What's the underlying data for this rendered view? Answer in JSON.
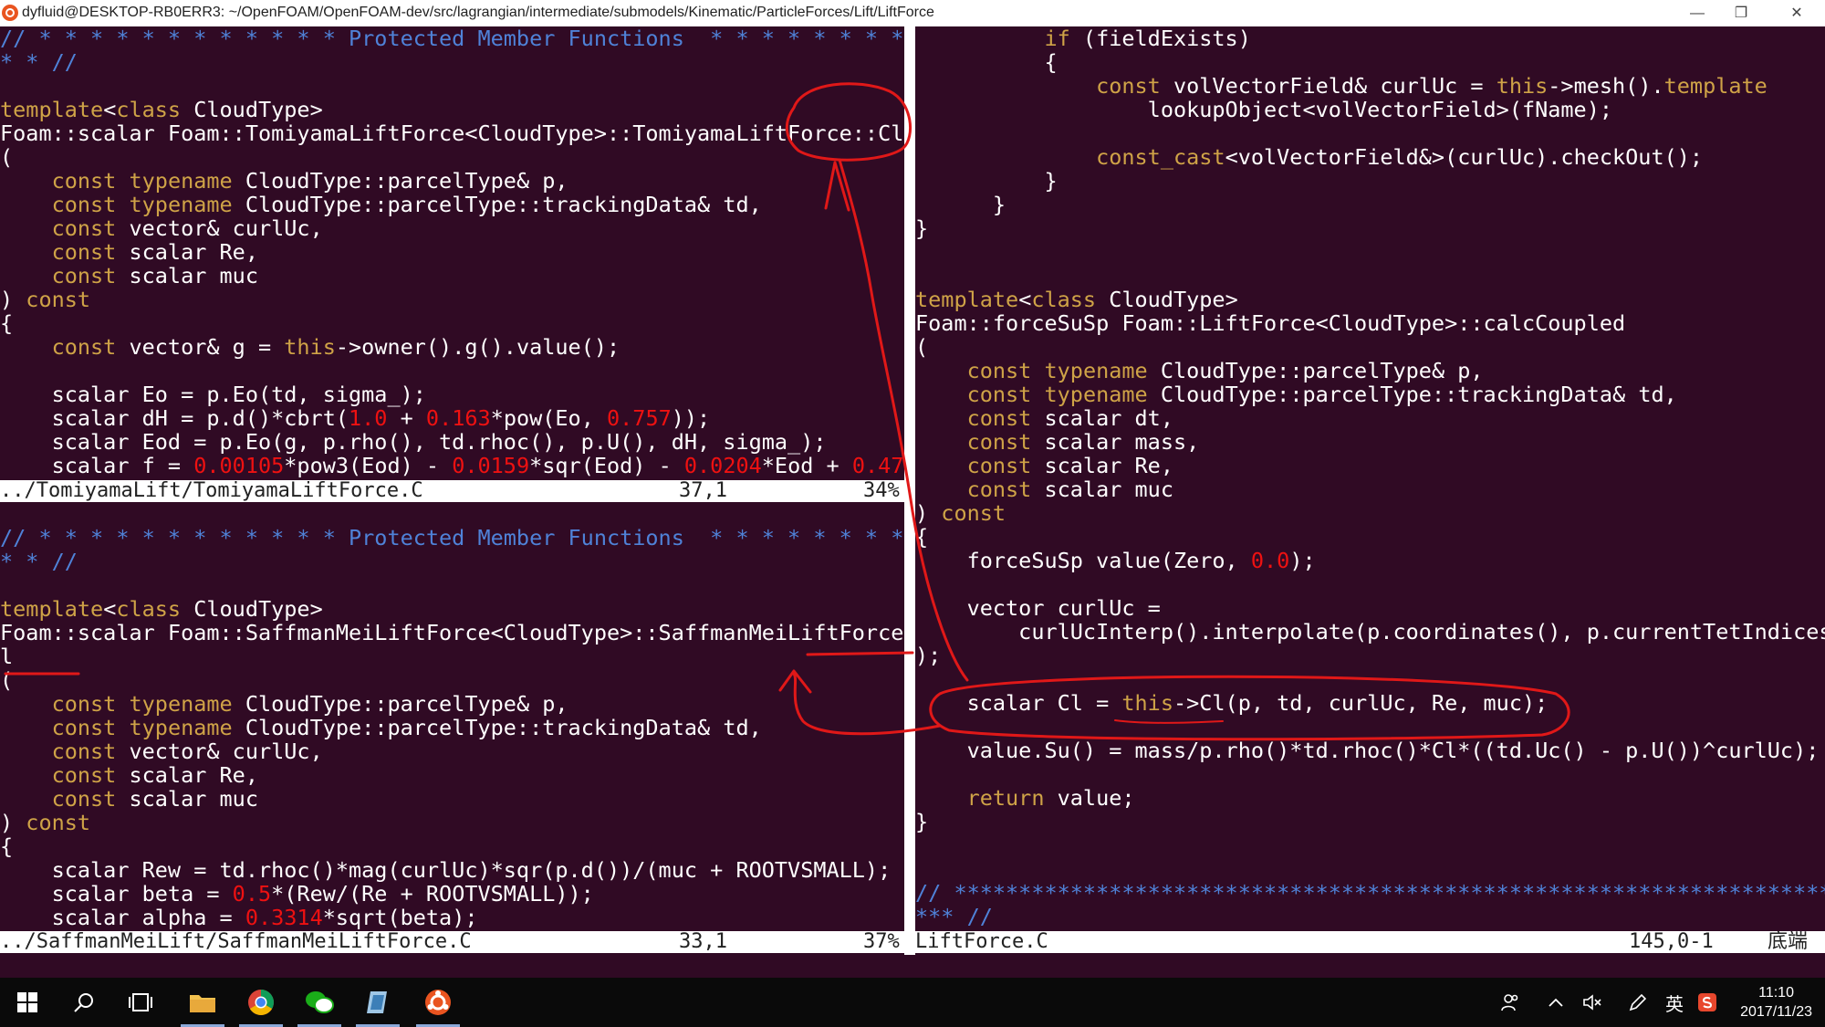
{
  "window": {
    "title": "dyfluid@DESKTOP-RB0ERR3: ~/OpenFOAM/OpenFOAM-dev/src/lagrangian/intermediate/submodels/Kinematic/ParticleForces/Lift/LiftForce",
    "min_label": "—",
    "max_label": "❐",
    "close_label": "✕"
  },
  "top_left_pane": {
    "status": {
      "file": "../TomiyamaLift/TomiyamaLiftForce.C",
      "pos": "37,1",
      "pct": "34%"
    }
  },
  "bottom_left_pane": {
    "status": {
      "file": "../SaffmanMeiLift/SaffmanMeiLiftForce.C",
      "pos": "33,1",
      "pct": "37%"
    }
  },
  "right_pane": {
    "status": {
      "file": "LiftForce.C",
      "pos": "145,0-1",
      "pct": "底端"
    }
  },
  "taskbar": {
    "clock_time": "11:10",
    "clock_date": "2017/11/23",
    "ime_label": "英",
    "icons": [
      "windows-start-icon",
      "search-icon",
      "task-view-icon",
      "file-explorer-icon",
      "chrome-icon",
      "wechat-icon",
      "app-icon",
      "ubuntu-icon"
    ]
  },
  "annotation_color": "#e01818"
}
